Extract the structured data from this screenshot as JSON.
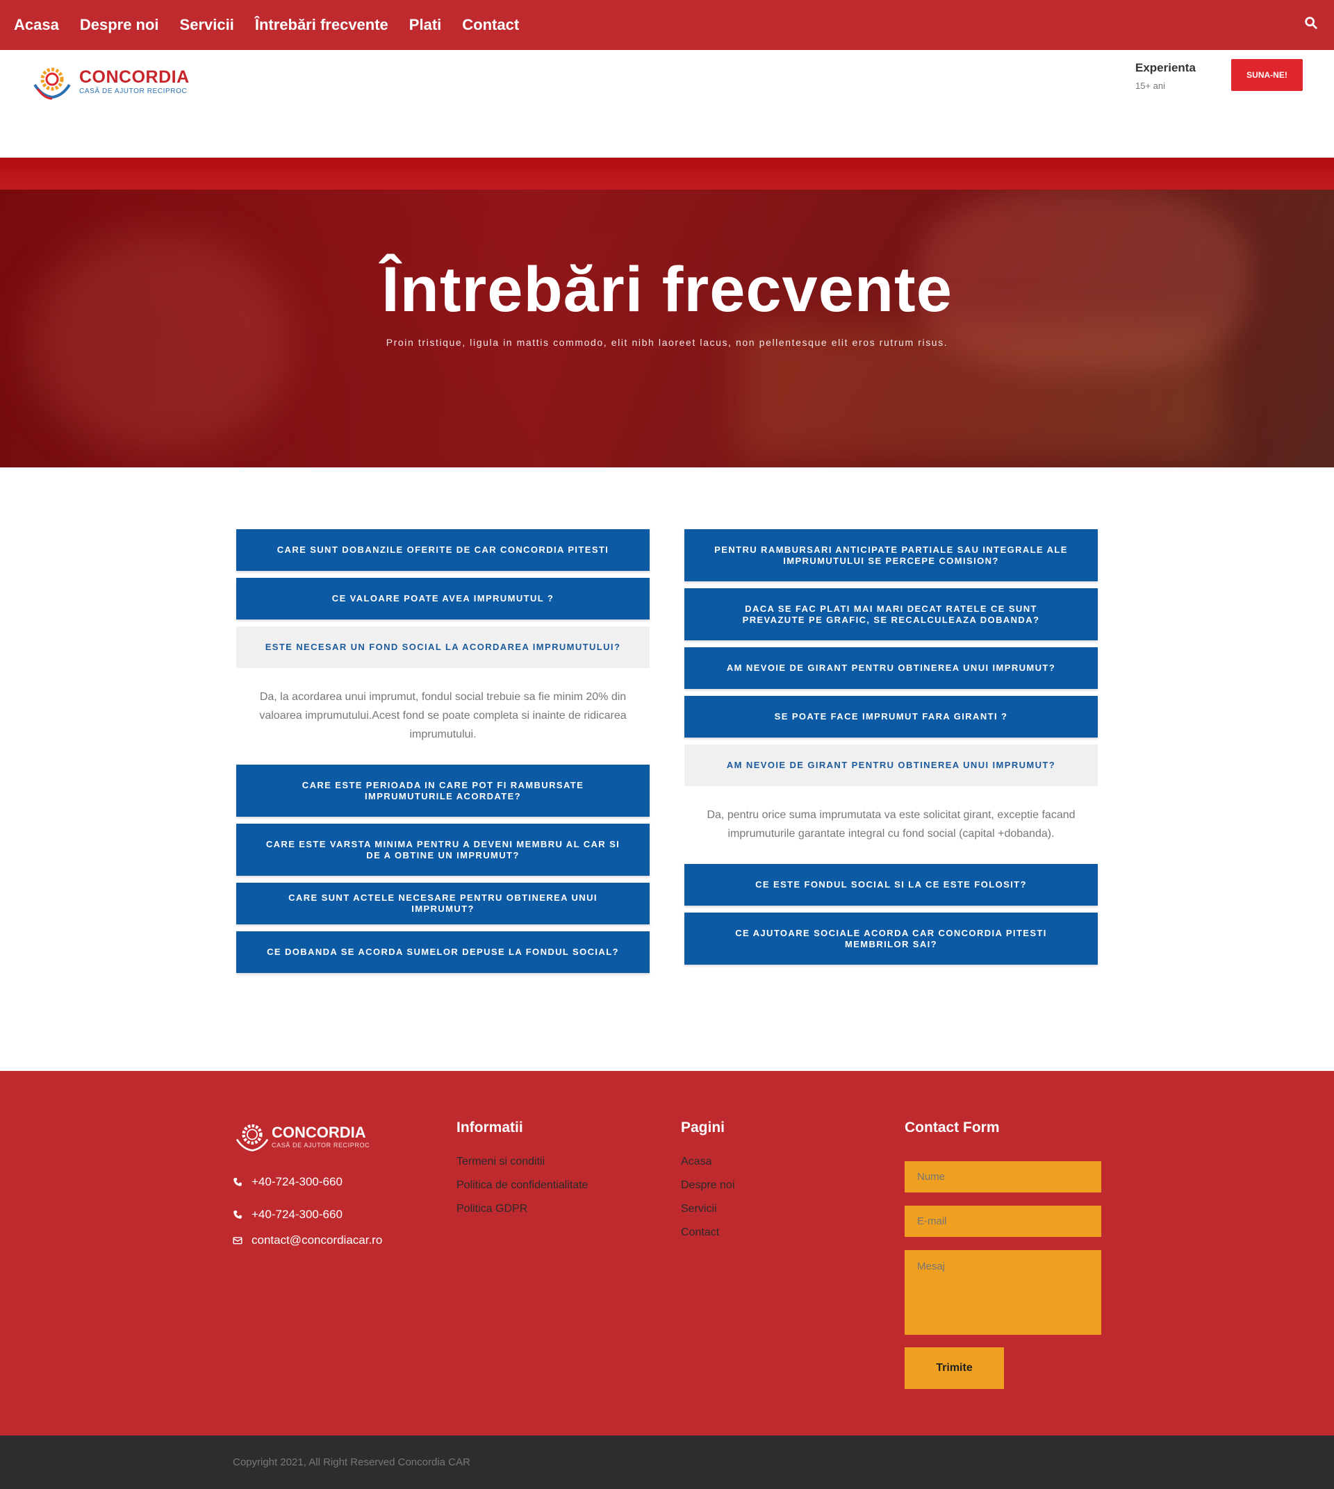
{
  "nav": {
    "items": [
      "Acasa",
      "Despre noi",
      "Servicii",
      "Întrebări frecvente",
      "Plati",
      "Contact"
    ]
  },
  "header": {
    "brand": "CONCORDIA",
    "tagline": "CASĂ DE AJUTOR RECIPROC",
    "experience_label": "Experienta",
    "experience_value": "15+ ani",
    "call_button": "SUNA-NE!"
  },
  "hero": {
    "title": "Întrebări frecvente",
    "subtitle": "Proin tristique, ligula in mattis commodo, elit nibh laoreet lacus, non pellentesque elit eros rutrum risus."
  },
  "faq": {
    "left": [
      {
        "q": "CARE SUNT DOBANZILE OFERITE DE CAR CONCORDIA PITESTI"
      },
      {
        "q": "CE VALOARE POATE AVEA IMPRUMUTUL ?"
      },
      {
        "q": "ESTE NECESAR UN FOND SOCIAL LA ACORDAREA IMPRUMUTULUI?",
        "a": "Da, la acordarea unui imprumut, fondul social trebuie sa fie minim 20% din valoarea imprumutului.Acest fond se poate completa si inainte de ridicarea imprumutului."
      },
      {
        "q": "CARE ESTE PERIOADA IN CARE POT FI RAMBURSATE IMPRUMUTURILE ACORDATE?"
      },
      {
        "q": "CARE ESTE VARSTA MINIMA PENTRU A DEVENI MEMBRU AL CAR SI DE A OBTINE UN IMPRUMUT?"
      },
      {
        "q": "CARE SUNT ACTELE NECESARE PENTRU OBTINEREA UNUI IMPRUMUT?"
      },
      {
        "q": "CE DOBANDA SE ACORDA SUMELOR DEPUSE LA FONDUL SOCIAL?"
      }
    ],
    "right": [
      {
        "q": "PENTRU RAMBURSARI ANTICIPATE PARTIALE SAU INTEGRALE ALE IMPRUMUTULUI SE PERCEPE COMISION?"
      },
      {
        "q": "DACA SE FAC PLATI MAI MARI DECAT RATELE CE SUNT PREVAZUTE PE GRAFIC, SE RECALCULEAZA DOBANDA?"
      },
      {
        "q": "AM NEVOIE DE GIRANT PENTRU OBTINEREA UNUI IMPRUMUT?"
      },
      {
        "q": "SE POATE FACE IMPRUMUT FARA GIRANTI ?"
      },
      {
        "q": "AM NEVOIE DE GIRANT PENTRU OBTINEREA UNUI IMPRUMUT?",
        "a": "Da, pentru orice suma imprumutata va este solicitat girant, exceptie facand imprumuturile garantate integral cu fond social (capital +dobanda)."
      },
      {
        "q": "CE ESTE FONDUL SOCIAL SI LA CE ESTE FOLOSIT?"
      },
      {
        "q": "CE AJUTOARE SOCIALE ACORDA CAR CONCORDIA PITESTI MEMBRILOR SAI?"
      }
    ]
  },
  "footer": {
    "brand": "CONCORDIA",
    "tagline": "CASĂ DE AJUTOR RECIPROC",
    "phone1": "+40-724-300-660",
    "phone2": "+40-724-300-660",
    "email": "contact@concordiacar.ro",
    "informatii": {
      "title": "Informatii",
      "links": [
        "Termeni si conditii",
        "Politica de confidentialitate",
        "Politica GDPR"
      ]
    },
    "pagini": {
      "title": "Pagini",
      "links": [
        "Acasa",
        "Despre noi",
        "Servicii",
        "Contact"
      ]
    },
    "contact_form": {
      "title": "Contact Form",
      "name_placeholder": "Nume",
      "email_placeholder": "E-mail",
      "message_placeholder": "Mesaj",
      "submit": "Trimite"
    }
  },
  "copyright": "Copyright 2021, All Right Reserved Concordia CAR",
  "colors": {
    "primary_red": "#bf2a2f",
    "faq_blue": "#0d5aa4",
    "accent_orange": "#f0a020",
    "dark_footer": "#2d2d2f"
  },
  "icons": {
    "search": "search-icon",
    "phone": "phone-icon",
    "email": "envelope-icon",
    "logo": "laurel-logo-icon"
  }
}
